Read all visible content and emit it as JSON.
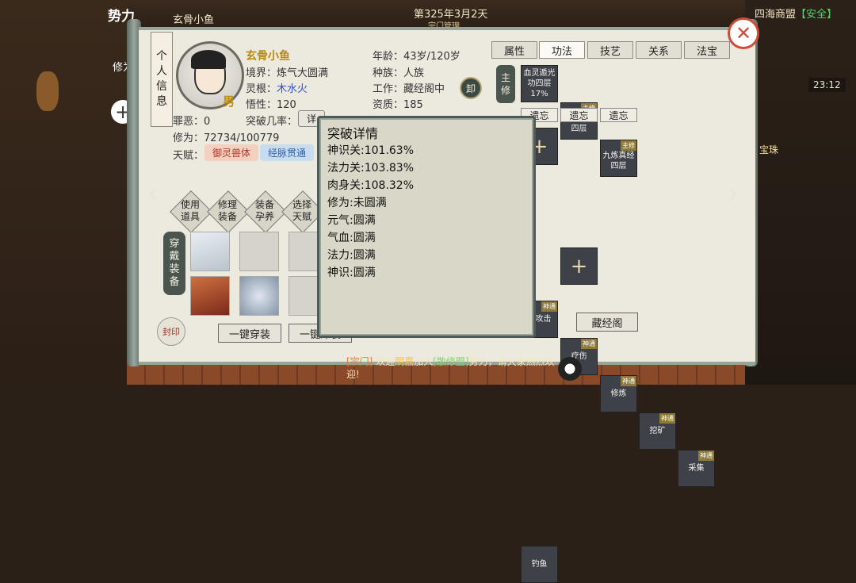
{
  "topbar": {
    "left_title": "势力",
    "player_name": "玄骨小鱼",
    "date": "第325年3月2天",
    "sub_menu": "宗门管理",
    "alliance": "四海商盟",
    "status": "【安全】",
    "time": "23:12"
  },
  "side": {
    "repair_label": "修为",
    "gem_label": "宝珠"
  },
  "profile": {
    "banner": [
      "个",
      "人",
      "信",
      "息"
    ],
    "gender": "男",
    "name": "玄骨小鱼",
    "realm_label": "境界：",
    "realm": "炼气大圆满",
    "root_label": "灵根：",
    "root": "木水火",
    "wisdom_label": "悟性：",
    "wisdom": "120",
    "sin_label": "罪恶：",
    "sin": "0",
    "breakthrough_label": "突破几率：",
    "detail_button": "详",
    "cultivation_label": "修为：",
    "cultivation": "72734/100779",
    "talent_label": "天赋：",
    "talents": [
      "御灵兽体",
      "经脉贯通"
    ],
    "age_label": "年龄：",
    "age": "43岁/120岁",
    "race_label": "种族：",
    "race": "人族",
    "job_label": "工作：",
    "job": "藏经阁中",
    "unload_button": "卸",
    "aptitude_label": "资质：",
    "aptitude": "185"
  },
  "actions": [
    {
      "l1": "使用",
      "l2": "道具"
    },
    {
      "l1": "修理",
      "l2": "装备"
    },
    {
      "l1": "装备",
      "l2": "孕养"
    },
    {
      "l1": "选择",
      "l2": "天赋"
    }
  ],
  "equip": {
    "side_label": [
      "穿",
      "戴",
      "装",
      "备"
    ],
    "equip_all_button": "一键穿装",
    "unequip_all_button": "一键卸装",
    "seal_label": "封印"
  },
  "tabs": [
    "属性",
    "功法",
    "技艺",
    "关系",
    "法宝"
  ],
  "active_tab": "功法",
  "skills": {
    "main_label": [
      "主",
      "修"
    ],
    "main": [
      {
        "name": "血灵遁光功四层",
        "extra": "17%"
      },
      {
        "name": "天河宝典四层",
        "tag": "主修"
      },
      {
        "name": "九炼真经四层",
        "tag": "主修"
      }
    ],
    "forget_label": "遗忘",
    "secondary": [
      {
        "name": "通攻击",
        "tag": "神通"
      },
      {
        "name": "疗伤",
        "tag": "神通"
      },
      {
        "name": "修炼",
        "tag": "神通"
      },
      {
        "name": "挖矿",
        "tag": "神通"
      },
      {
        "name": "采集",
        "tag": "神通"
      }
    ],
    "third": [
      {
        "name": "钓鱼"
      }
    ],
    "library_button": "藏经阁"
  },
  "popup": {
    "title": "突破详情",
    "lines": [
      "神识关:101.63%",
      "法力关:103.83%",
      "肉身关:108.32%",
      "修为:未圆满",
      "元气:圆满",
      "气血:圆满",
      "法力:圆满",
      "神识:圆满"
    ]
  },
  "chat": {
    "channel": "[宗门]",
    "text1": "欢迎",
    "player": "阴嘉",
    "text2": "加入",
    "sect": "[散修盟]",
    "text3": "势力，请大家热烈欢迎!"
  },
  "colors": {
    "accent": "#b88a0f",
    "close": "#d24b3a",
    "talent1_bg": "#f3d0c0",
    "talent2_bg": "#c9dcef"
  }
}
